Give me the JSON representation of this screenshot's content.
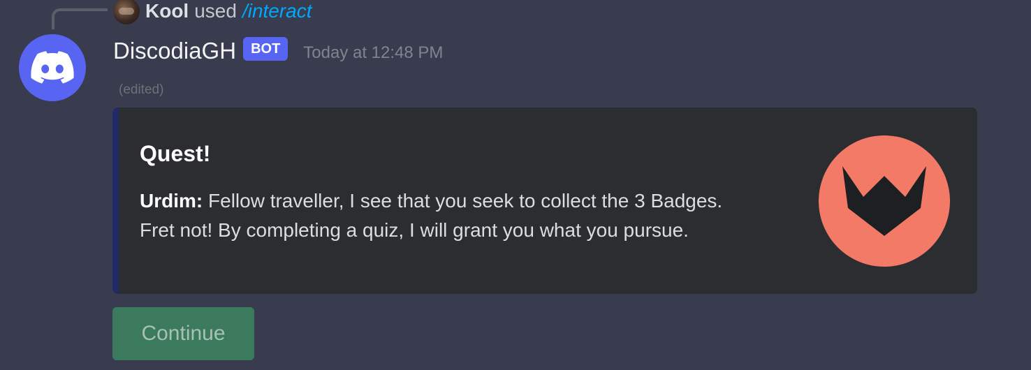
{
  "reply": {
    "user": "Kool",
    "action": "used",
    "command": "/interact"
  },
  "message": {
    "author": "DiscodiaGH",
    "badge": "BOT",
    "timestamp": "Today at 12:48 PM",
    "edited_label": "(edited)"
  },
  "embed": {
    "title": "Quest!",
    "speaker": "Urdim:",
    "line1": " Fellow traveller, I see that you seek to collect the 3 Badges.",
    "line2": "Fret not! By completing a quiz, I will grant you what you pursue.",
    "accent_color": "#1f2a66",
    "thumbnail_color": "#f27a67",
    "thumbnail_icon": "chevron-emblem-icon"
  },
  "actions": {
    "continue_label": "Continue"
  },
  "colors": {
    "background": "#393c4e",
    "blurple": "#5865f2",
    "success_button": "#3b7a5c"
  }
}
